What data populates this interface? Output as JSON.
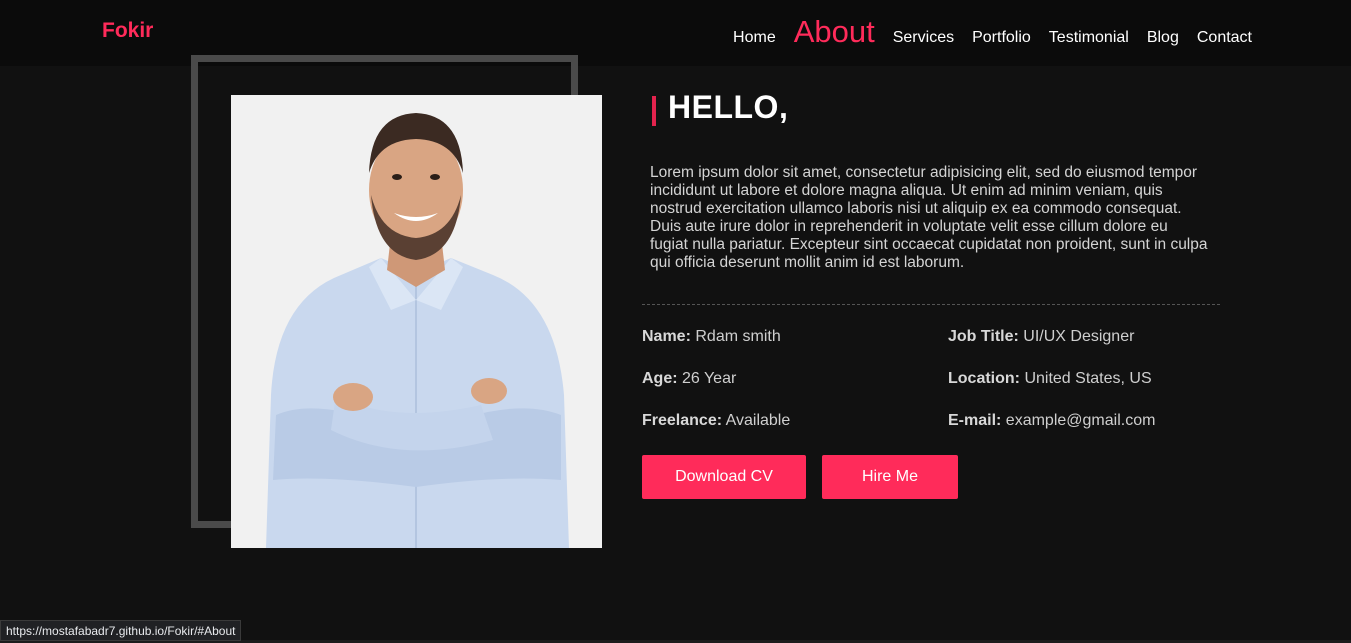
{
  "brand": {
    "logo": "Fokir",
    "accent_color": "#ff2b5a"
  },
  "nav": {
    "items": [
      {
        "label": "Home",
        "active": false
      },
      {
        "label": "About",
        "active": true
      },
      {
        "label": "Services",
        "active": false
      },
      {
        "label": "Portfolio",
        "active": false
      },
      {
        "label": "Testimonial",
        "active": false
      },
      {
        "label": "Blog",
        "active": false
      },
      {
        "label": "Contact",
        "active": false
      }
    ]
  },
  "about": {
    "heading": "HELLO,",
    "bio": "Lorem ipsum dolor sit amet, consectetur adipisicing elit, sed do eiusmod tempor incididunt ut labore et dolore magna aliqua. Ut enim ad minim veniam, quis nostrud exercitation ullamco laboris nisi ut aliquip ex ea commodo consequat. Duis aute irure dolor in reprehenderit in voluptate velit esse cillum dolore eu fugiat nulla pariatur. Excepteur sint occaecat cupidatat non proident, sunt in culpa qui officia deserunt mollit anim id est laborum.",
    "info": {
      "name": {
        "label": "Name:",
        "value": "Rdam smith"
      },
      "job_title": {
        "label": "Job Title:",
        "value": "UI/UX Designer"
      },
      "age": {
        "label": "Age:",
        "value": "26 Year"
      },
      "location": {
        "label": "Location:",
        "value": "United States, US"
      },
      "freelance": {
        "label": "Freelance:",
        "value": "Available"
      },
      "email": {
        "label": "E-mail:",
        "value": "example@gmail.com"
      }
    },
    "buttons": {
      "download_cv": "Download CV",
      "hire_me": "Hire Me"
    }
  },
  "status_bar": {
    "url": "https://mostafabadr7.github.io/Fokir/#About"
  }
}
